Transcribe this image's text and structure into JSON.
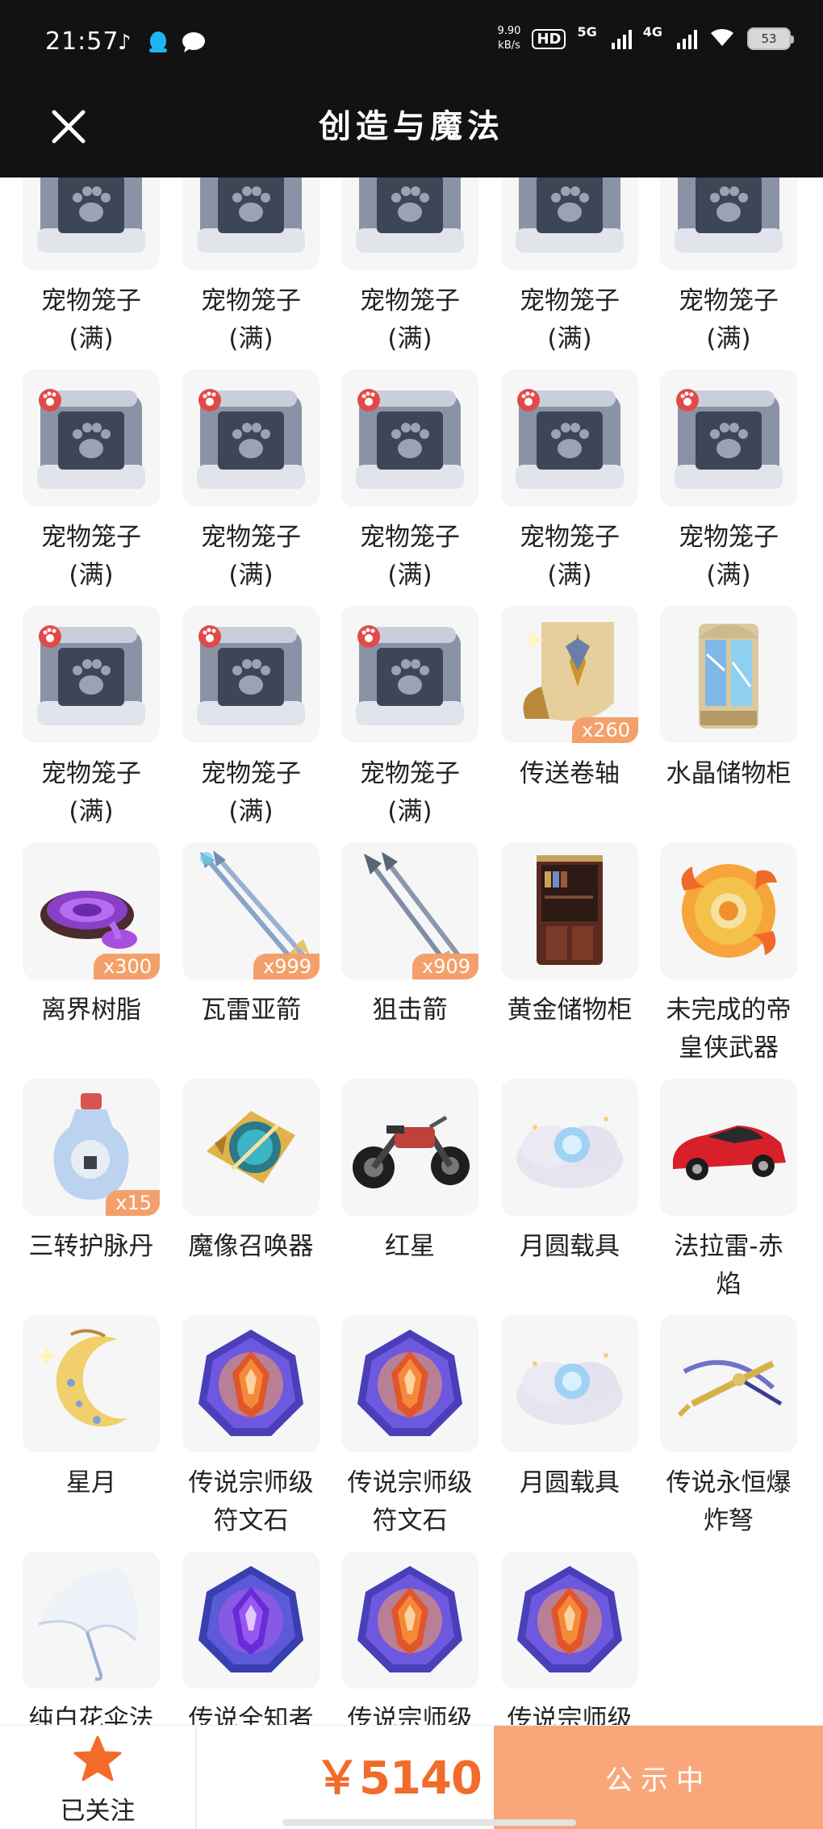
{
  "status_bar": {
    "time": "21:57",
    "net_speed_value": "9.90",
    "net_speed_unit": "kB/s",
    "hd_label": "HD",
    "net1": "5G",
    "net2": "4G",
    "battery": "53"
  },
  "header": {
    "title": "创造与魔法",
    "close_icon": "close-icon"
  },
  "items": [
    {
      "name": "宠物笼子\n(满)",
      "icon": "pet-cage",
      "qty": ""
    },
    {
      "name": "宠物笼子\n(满)",
      "icon": "pet-cage",
      "qty": ""
    },
    {
      "name": "宠物笼子\n(满)",
      "icon": "pet-cage",
      "qty": ""
    },
    {
      "name": "宠物笼子\n(满)",
      "icon": "pet-cage",
      "qty": ""
    },
    {
      "name": "宠物笼子\n(满)",
      "icon": "pet-cage",
      "qty": ""
    },
    {
      "name": "宠物笼子\n(满)",
      "icon": "pet-cage",
      "qty": ""
    },
    {
      "name": "宠物笼子\n(满)",
      "icon": "pet-cage",
      "qty": ""
    },
    {
      "name": "宠物笼子\n(满)",
      "icon": "pet-cage",
      "qty": ""
    },
    {
      "name": "宠物笼子\n(满)",
      "icon": "pet-cage",
      "qty": ""
    },
    {
      "name": "宠物笼子\n(满)",
      "icon": "pet-cage",
      "qty": ""
    },
    {
      "name": "宠物笼子\n(满)",
      "icon": "pet-cage",
      "qty": ""
    },
    {
      "name": "宠物笼子\n(满)",
      "icon": "pet-cage",
      "qty": ""
    },
    {
      "name": "宠物笼子\n(满)",
      "icon": "pet-cage",
      "qty": ""
    },
    {
      "name": "传送卷轴",
      "icon": "scroll",
      "qty": "x260"
    },
    {
      "name": "水晶储物柜",
      "icon": "crystal-cabinet",
      "qty": ""
    },
    {
      "name": "离界树脂",
      "icon": "resin",
      "qty": "x300"
    },
    {
      "name": "瓦雷亚箭",
      "icon": "arrows-gold",
      "qty": "x999"
    },
    {
      "name": "狙击箭",
      "icon": "arrows-steel",
      "qty": "x909"
    },
    {
      "name": "黄金储物柜",
      "icon": "gold-cabinet",
      "qty": ""
    },
    {
      "name": "未完成的帝\n皇侠武器",
      "icon": "fire-orb",
      "qty": ""
    },
    {
      "name": "三转护脉丹",
      "icon": "potion",
      "qty": "x15"
    },
    {
      "name": "魔像召唤器",
      "icon": "golem-summoner",
      "qty": ""
    },
    {
      "name": "红星",
      "icon": "motorcycle",
      "qty": ""
    },
    {
      "name": "月圆载具",
      "icon": "moon-cloud",
      "qty": ""
    },
    {
      "name": "法拉雷-赤\n焰",
      "icon": "red-car",
      "qty": ""
    },
    {
      "name": "星月",
      "icon": "crescent-moon",
      "qty": ""
    },
    {
      "name": "传说宗师级\n符文石",
      "icon": "rune-orange",
      "qty": ""
    },
    {
      "name": "传说宗师级\n符文石",
      "icon": "rune-orange",
      "qty": ""
    },
    {
      "name": "月圆载具",
      "icon": "moon-cloud",
      "qty": ""
    },
    {
      "name": "传说永恒爆\n炸弩",
      "icon": "crossbow",
      "qty": ""
    },
    {
      "name": "纯白花伞法\n杖",
      "icon": "umbrella",
      "qty": ""
    },
    {
      "name": "传说全知者\n级符文石",
      "icon": "rune-purple",
      "qty": ""
    },
    {
      "name": "传说宗师级\n符文石",
      "icon": "rune-orange",
      "qty": ""
    },
    {
      "name": "传说宗师级\n符文石",
      "icon": "rune-orange",
      "qty": ""
    }
  ],
  "bottom": {
    "follow_label": "已关注",
    "price": "￥5140",
    "status_button": "公示中"
  },
  "colors": {
    "accent": "#f26b2a",
    "button": "#f9a77a",
    "badge": "#f4a06a",
    "header_bg": "#121212"
  }
}
